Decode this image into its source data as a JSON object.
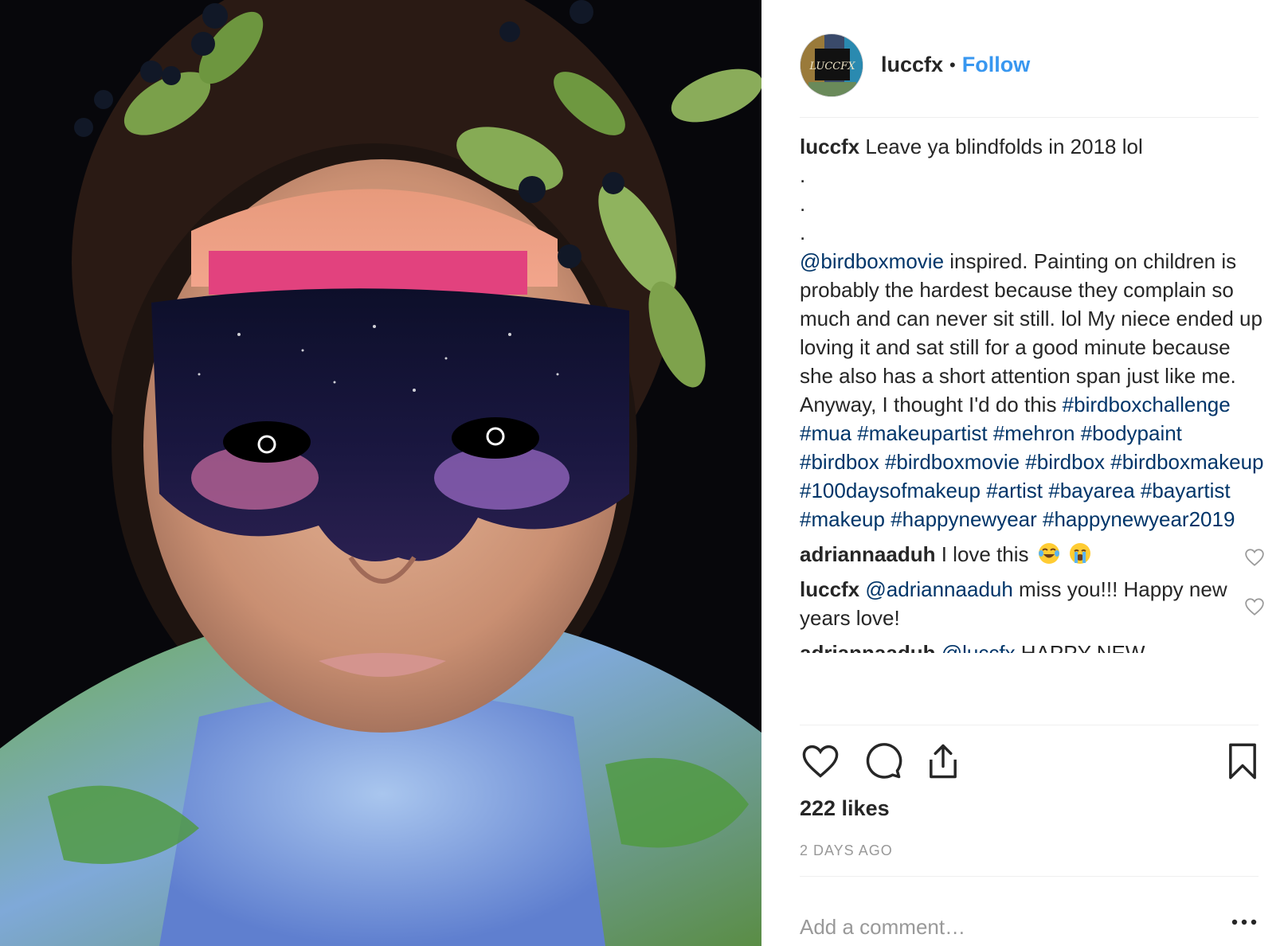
{
  "post": {
    "photo_alt": "Child with galaxy face paint blindfold, leafy berry crown, painted earth on shoulders"
  },
  "header": {
    "avatar_icon": "profile-avatar",
    "username": "luccfx",
    "separator": "•",
    "follow_label": "Follow"
  },
  "caption": {
    "user": "luccfx",
    "first_line": "Leave ya blindfolds in 2018 lol",
    "dots": [
      ".",
      ".",
      "."
    ],
    "mention": "@birdboxmovie",
    "body": " inspired. Painting on children is probably the hardest because they complain so much and can never sit still. lol My niece ended up loving it and sat still for a good minute because she also has a short attention span just like me. Anyway, I thought I'd do this ",
    "hashtags": [
      "#birdboxchallenge",
      "#mua",
      "#makeupartist",
      "#mehron",
      "#bodypaint",
      "#birdbox",
      "#birdboxmovie",
      "#birdbox",
      "#birdboxmakeup",
      "#100daysofmakeup",
      "#artist",
      "#bayarea",
      "#bayartist",
      "#makeup",
      "#happynewyear",
      "#happynewyear2019"
    ]
  },
  "comments": [
    {
      "user": "adriannaaduh",
      "text": "I love this",
      "emojis": [
        "joy-emoji",
        "sob-emoji"
      ]
    },
    {
      "user": "luccfx",
      "mention": "@adriannaaduh",
      "text": " miss you!!! Happy new years love!"
    },
    {
      "user": "adriannaaduh",
      "mention": "@luccfx",
      "text": " HAPPY NEW"
    }
  ],
  "actions": {
    "like_icon": "heart-icon",
    "comment_icon": "comment-icon",
    "share_icon": "share-icon",
    "save_icon": "bookmark-icon"
  },
  "likes": "222 likes",
  "time": "2 DAYS AGO",
  "add_comment": {
    "placeholder": "Add a comment…",
    "more_icon": "more-options-icon"
  },
  "colors": {
    "link": "#003569",
    "follow": "#3897f0",
    "muted": "#999999",
    "text": "#262626"
  }
}
